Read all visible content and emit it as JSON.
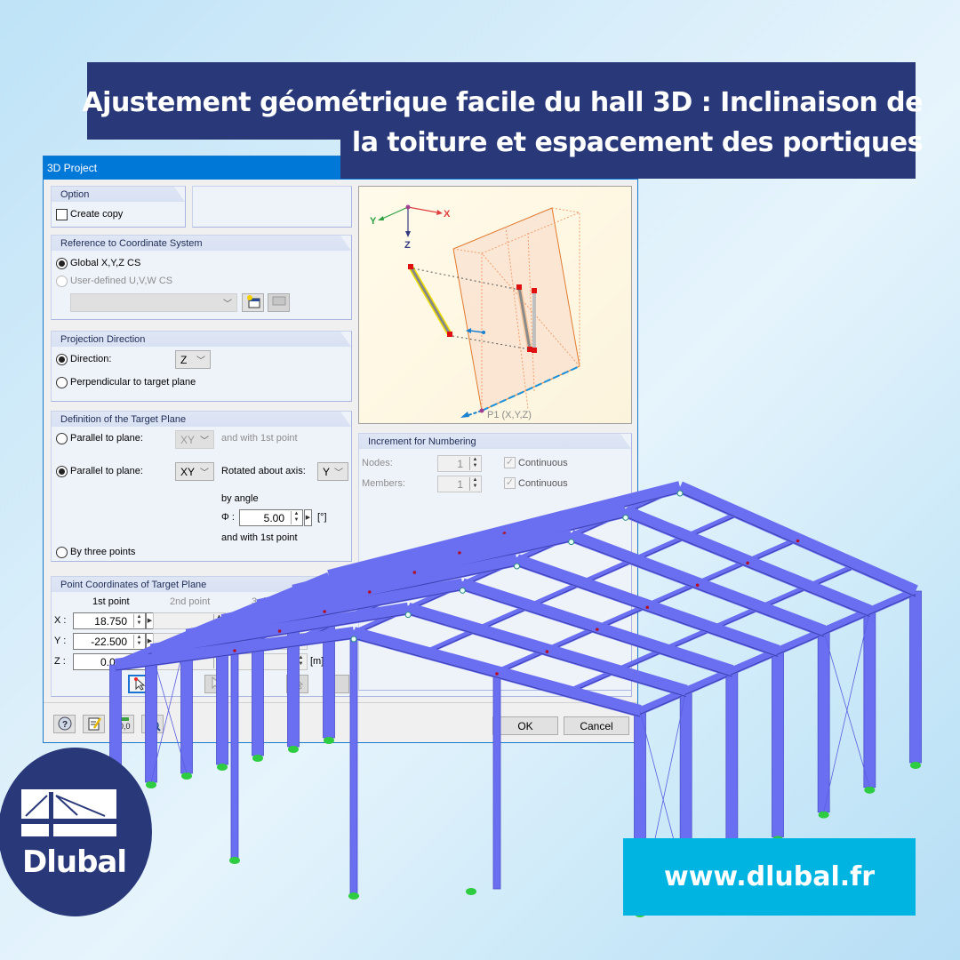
{
  "banner": {
    "line1": "Ajustement géométrique facile du hall 3D : Inclinaison de",
    "line2": "la toiture et espacement des portiques"
  },
  "dialog": {
    "title": "3D Project",
    "option": {
      "title": "Option",
      "create_copy_label": "Create copy",
      "create_copy_checked": false
    },
    "coordinate_system": {
      "title": "Reference to Coordinate System",
      "global_label": "Global X,Y,Z CS",
      "global_selected": true,
      "user_defined_label": "User-defined U,V,W CS",
      "user_defined_selected": false,
      "cs_select_value": ""
    },
    "projection": {
      "title": "Projection Direction",
      "direction_label": "Direction:",
      "direction_selected": true,
      "direction_value": "Z",
      "perpendicular_label": "Perpendicular to target plane",
      "perpendicular_selected": false
    },
    "target_plane": {
      "title": "Definition of the Target Plane",
      "parallel1_label": "Parallel to plane:",
      "parallel1_value": "XY",
      "parallel1_suffix": "and with 1st point",
      "parallel1_selected": false,
      "parallel2_label": "Parallel to plane:",
      "parallel2_value": "XY",
      "parallel2_selected": true,
      "rotated_label": "Rotated about axis:",
      "rotated_value": "Y",
      "by_angle_label": "by angle",
      "phi_label": "Φ :",
      "phi_value": "5.00",
      "phi_unit": "[°]",
      "and_with_label": "and with 1st point",
      "three_points_label": "By three points",
      "three_points_selected": false
    },
    "point_coords": {
      "title": "Point Coordinates of Target Plane",
      "col1": "1st point",
      "col2": "2nd point",
      "col3": "3rd point",
      "x_label": "X :",
      "y_label": "Y :",
      "z_label": "Z :",
      "x1": "18.750",
      "y1": "-22.500",
      "z1": "0.000",
      "unit": "[m]"
    },
    "preview": {
      "axis_x": "X",
      "axis_y": "Y",
      "axis_z": "Z",
      "point_label": "P1 (X,Y,Z)"
    },
    "numbering": {
      "title": "Increment for Numbering",
      "nodes_label": "Nodes:",
      "nodes_value": "1",
      "members_label": "Members:",
      "members_value": "1",
      "continuous_label": "Continuous",
      "nodes_continuous": true,
      "members_continuous": true
    },
    "buttons": {
      "ok": "OK",
      "cancel": "Cancel"
    },
    "footer_icons": [
      "help-icon",
      "edit-icon",
      "units-icon",
      "zoom-view-icon"
    ]
  },
  "structure": {
    "member_color": "#6a6ef0",
    "support_color": "#2ecc40",
    "bays": 6,
    "roof_pitch_deg": 5
  },
  "logo": {
    "brand": "Dlubal"
  },
  "url": "www.dlubal.fr",
  "colors": {
    "banner": "#283878",
    "url_banner": "#00b4e1",
    "title_bar": "#0078d7"
  }
}
